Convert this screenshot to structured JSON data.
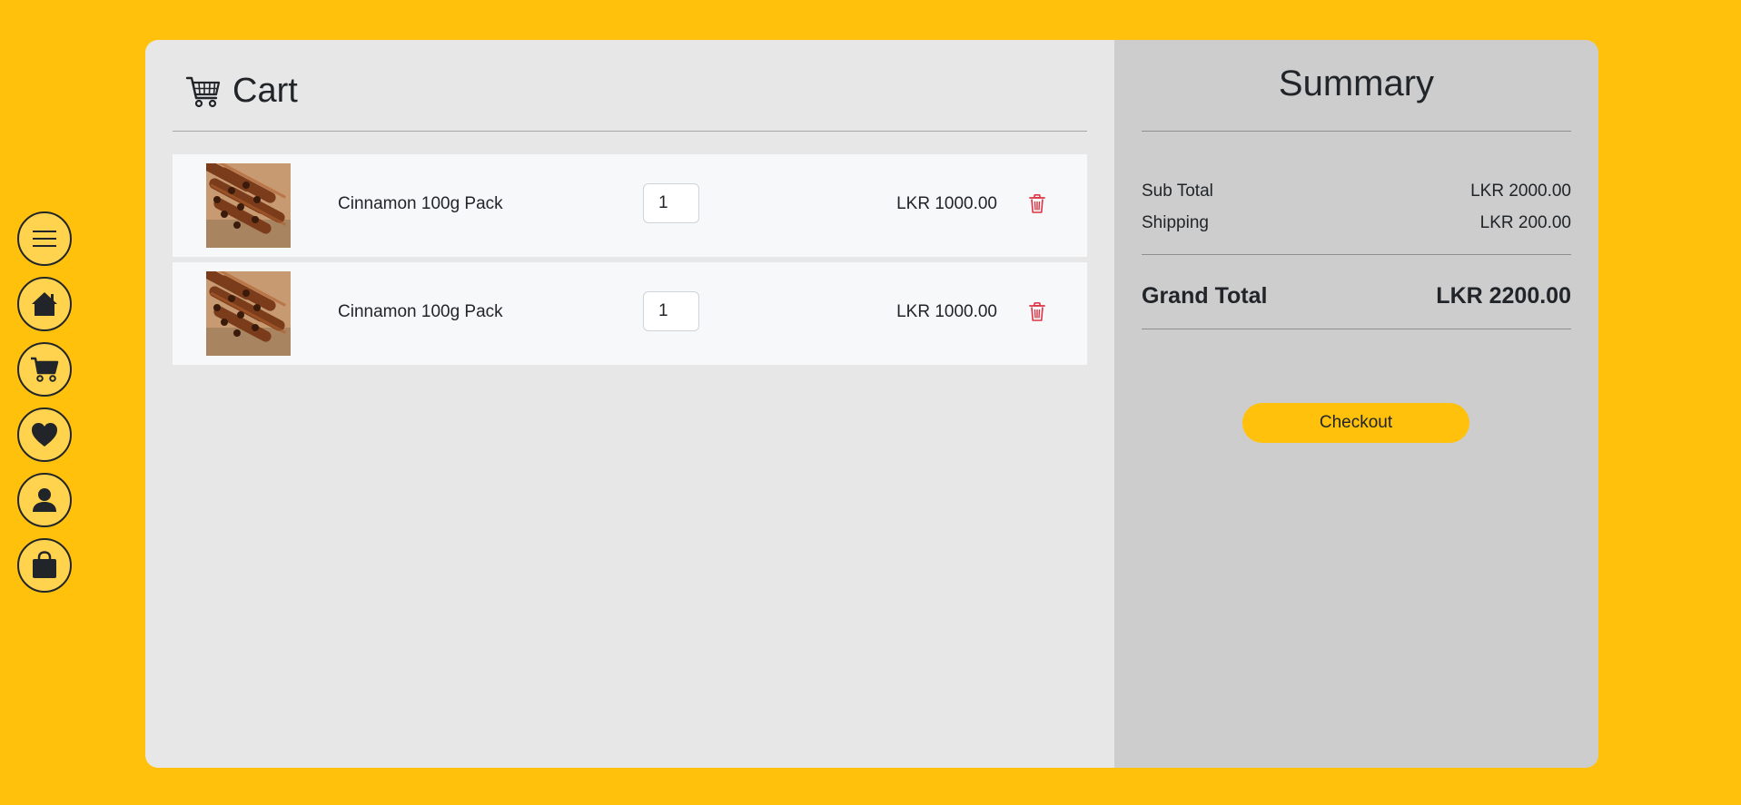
{
  "nav": {
    "items": [
      {
        "icon": "menu-icon"
      },
      {
        "icon": "home-icon"
      },
      {
        "icon": "cart-icon"
      },
      {
        "icon": "heart-icon"
      },
      {
        "icon": "user-icon"
      },
      {
        "icon": "bag-icon"
      }
    ]
  },
  "cart": {
    "title": "Cart",
    "items": [
      {
        "name": "Cinnamon 100g Pack",
        "quantity": "1",
        "price": "LKR 1000.00",
        "image": "cinnamon-sticks-thumbnail"
      },
      {
        "name": "Cinnamon 100g Pack",
        "quantity": "1",
        "price": "LKR 1000.00",
        "image": "cinnamon-sticks-thumbnail"
      }
    ]
  },
  "summary": {
    "title": "Summary",
    "subtotal_label": "Sub Total",
    "subtotal_value": "LKR 2000.00",
    "shipping_label": "Shipping",
    "shipping_value": "LKR 200.00",
    "grand_label": "Grand Total",
    "grand_value": "LKR 2200.00",
    "checkout_label": "Checkout"
  },
  "colors": {
    "background": "#FFC10C",
    "nav_button": "#FFD34D",
    "cart_panel": "#E7E7E7",
    "summary_panel": "#CDCDCD",
    "delete": "#DC3545"
  }
}
